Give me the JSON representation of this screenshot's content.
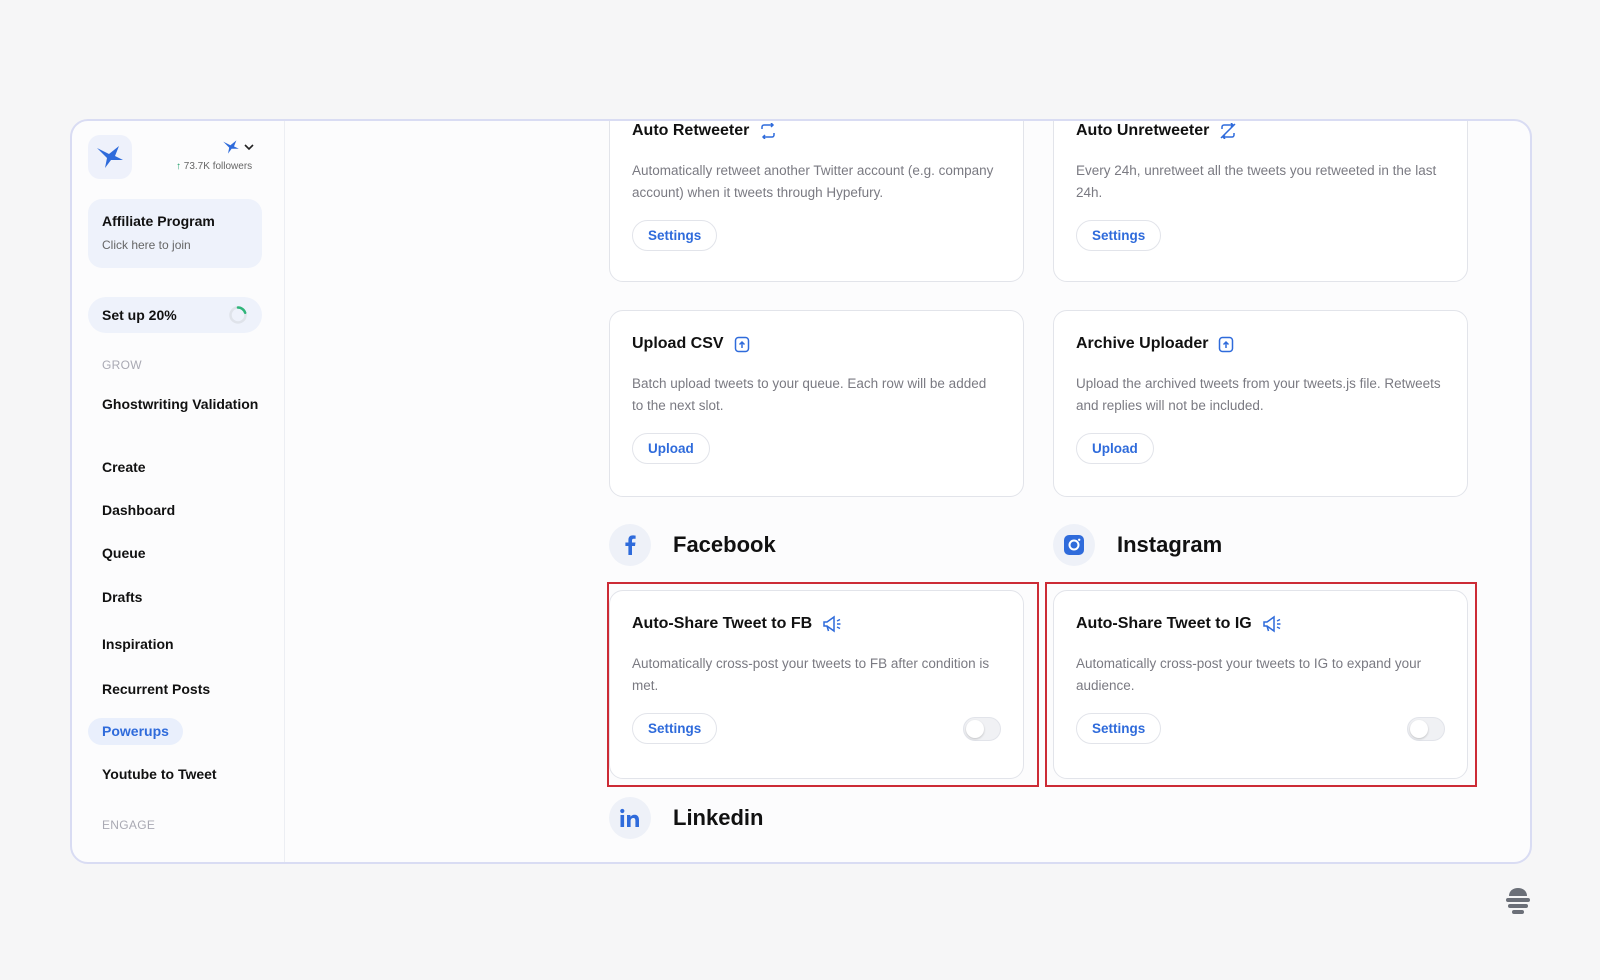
{
  "sidebar": {
    "followers": "73.7K followers",
    "affiliate": {
      "title": "Affiliate Program",
      "subtitle": "Click here to join"
    },
    "setup": {
      "label": "Set up 20%",
      "progress": 0.2
    },
    "sections": {
      "grow": "GROW",
      "engage": "ENGAGE"
    },
    "items": [
      {
        "label": "Ghostwriting Validation"
      },
      {
        "label": "Create"
      },
      {
        "label": "Dashboard"
      },
      {
        "label": "Queue"
      },
      {
        "label": "Drafts"
      },
      {
        "label": "Inspiration"
      },
      {
        "label": "Recurrent Posts"
      },
      {
        "label": "Powerups",
        "active": true
      },
      {
        "label": "Youtube to Tweet"
      }
    ]
  },
  "cards": {
    "auto_retweeter": {
      "title": "Auto Retweeter",
      "description": "Automatically retweet another Twitter account (e.g. company account) when it tweets through Hypefury.",
      "button": "Settings"
    },
    "auto_unretweeter": {
      "title": "Auto Unretweeter",
      "description": "Every 24h, unretweet all the tweets you retweeted in the last 24h.",
      "button": "Settings"
    },
    "upload_csv": {
      "title": "Upload CSV",
      "description": "Batch upload tweets to your queue. Each row will be added to the next slot.",
      "button": "Upload"
    },
    "archive_uploader": {
      "title": "Archive Uploader",
      "description": "Upload the archived tweets from your tweets.js file. Retweets and replies will not be included.",
      "button": "Upload"
    },
    "auto_share_fb": {
      "title": "Auto-Share Tweet to FB",
      "description": "Automatically cross-post your tweets to FB after condition is met.",
      "button": "Settings",
      "enabled": false
    },
    "auto_share_ig": {
      "title": "Auto-Share Tweet to IG",
      "description": "Automatically cross-post your tweets to IG to expand your audience.",
      "button": "Settings",
      "enabled": false
    }
  },
  "platforms": {
    "facebook": "Facebook",
    "instagram": "Instagram",
    "linkedin": "Linkedin"
  },
  "colors": {
    "accent": "#2f6bdb",
    "highlight": "#cc2b35"
  }
}
